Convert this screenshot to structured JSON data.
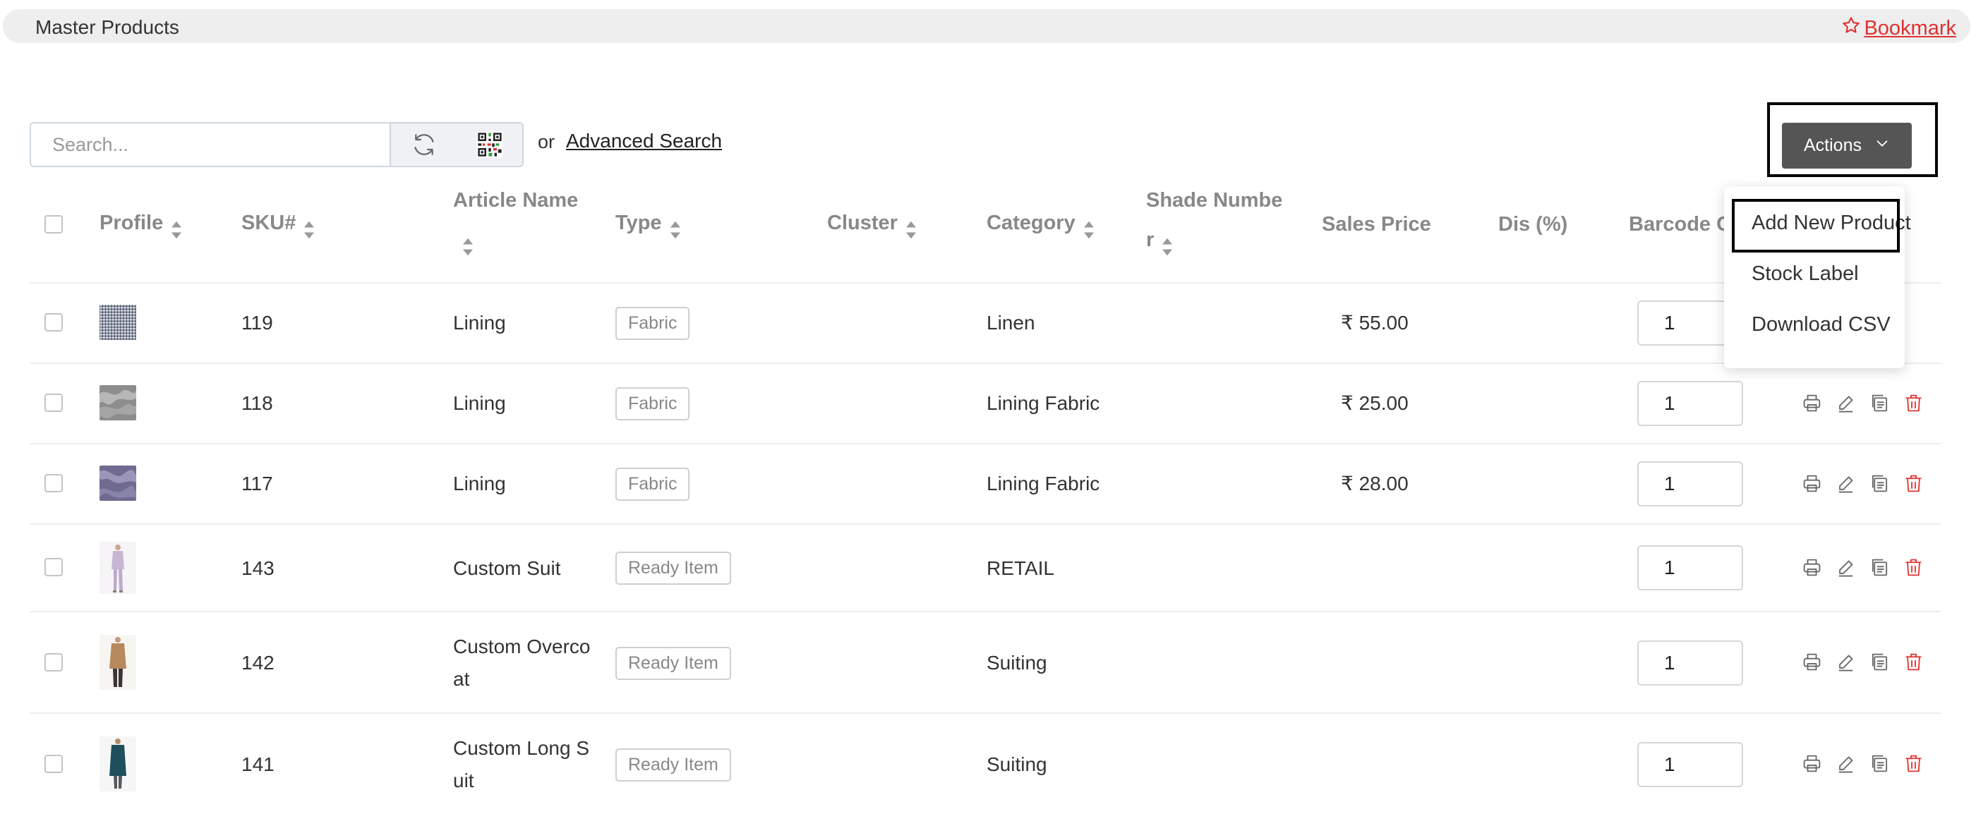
{
  "header": {
    "title": "Master Products",
    "bookmark_label": "Bookmark"
  },
  "search": {
    "placeholder": "Search...",
    "or_text": "or",
    "advanced_label": "Advanced Search"
  },
  "actions": {
    "label": "Actions",
    "menu": [
      "Add New Product",
      "Stock Label",
      "Download CSV"
    ]
  },
  "table": {
    "columns": {
      "profile": "Profile",
      "sku": "SKU#",
      "article_name": "Article Name",
      "type": "Type",
      "cluster": "Cluster",
      "category": "Category",
      "shade_line1": "Shade Numbe",
      "shade_line2": "r",
      "sales_price": "Sales Price",
      "discount": "Dis (%)",
      "barcode": "Barcode C"
    },
    "rows": [
      {
        "sku": "119",
        "name1": "Lining",
        "name2": "",
        "type": "Fabric",
        "category": "Linen",
        "price": "₹ 55.00",
        "qty": "1",
        "thumb": "checked-fabric"
      },
      {
        "sku": "118",
        "name1": "Lining",
        "name2": "",
        "type": "Fabric",
        "category": "Lining Fabric",
        "price": "₹ 25.00",
        "qty": "1",
        "thumb": "grey-fabric"
      },
      {
        "sku": "117",
        "name1": "Lining",
        "name2": "",
        "type": "Fabric",
        "category": "Lining Fabric",
        "price": "₹ 28.00",
        "qty": "1",
        "thumb": "lilac-fabric"
      },
      {
        "sku": "143",
        "name1": "Custom Suit",
        "name2": "",
        "type": "Ready Item",
        "category": "RETAIL",
        "price": "",
        "qty": "1",
        "thumb": "lavender-suit"
      },
      {
        "sku": "142",
        "name1": "Custom Overco",
        "name2": "at",
        "type": "Ready Item",
        "category": "Suiting",
        "price": "",
        "qty": "1",
        "thumb": "camel-overcoat"
      },
      {
        "sku": "141",
        "name1": "Custom Long S",
        "name2": "uit",
        "type": "Ready Item",
        "category": "Suiting",
        "price": "",
        "qty": "1",
        "thumb": "teal-long-suit"
      }
    ]
  },
  "colors": {
    "accent_red": "#e03131",
    "actions_bg": "#555555"
  }
}
